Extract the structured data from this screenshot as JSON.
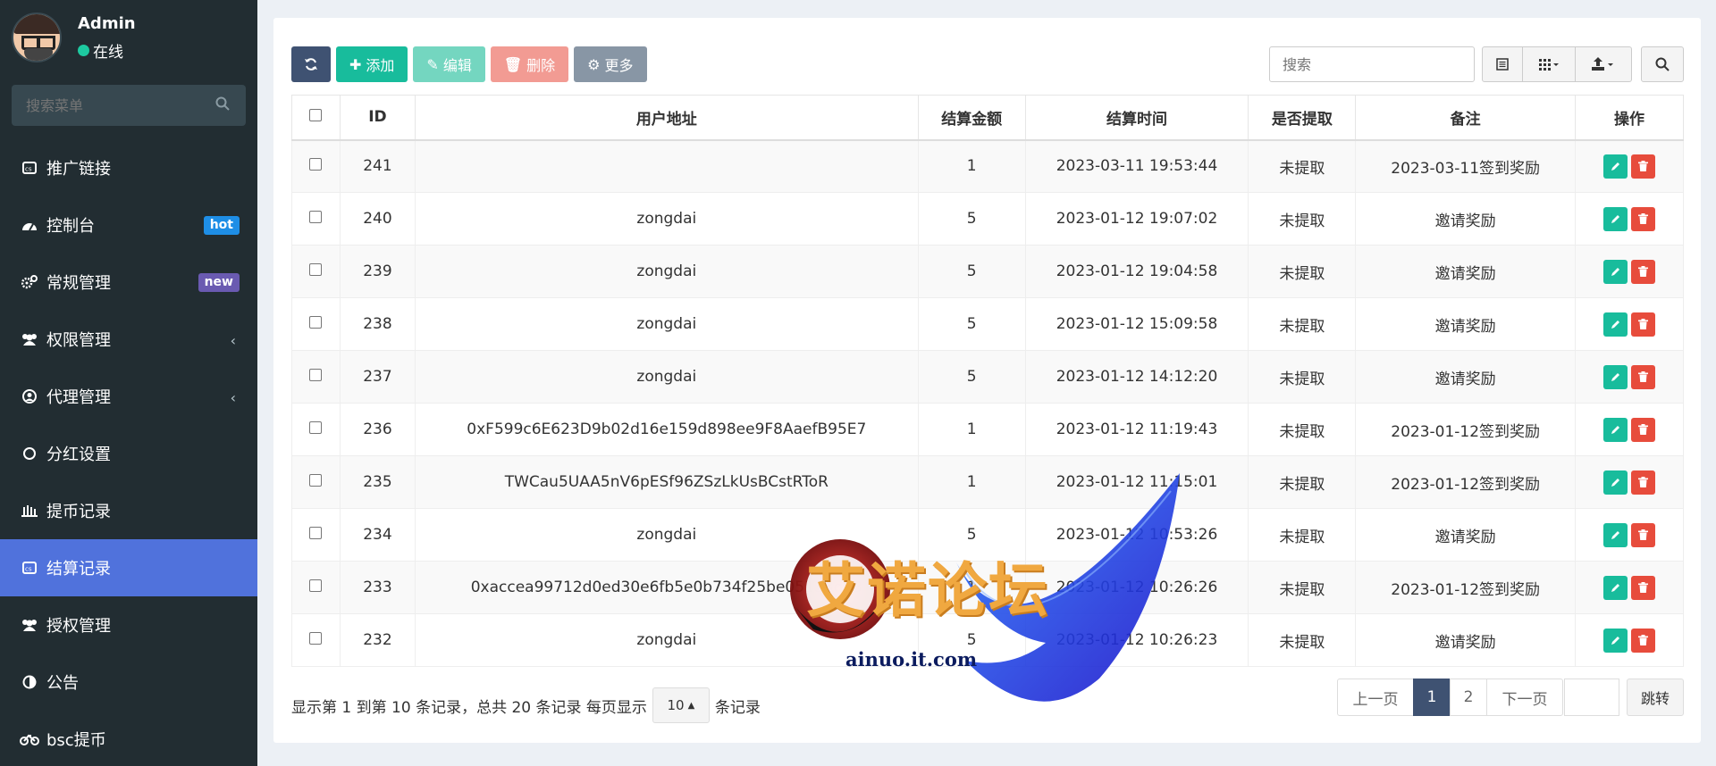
{
  "user": {
    "name": "Admin",
    "status": "在线"
  },
  "sidebar_search": {
    "placeholder": "搜索菜单"
  },
  "menu": [
    {
      "label": "推广链接",
      "icon": "link-icon"
    },
    {
      "label": "控制台",
      "icon": "dashboard-icon",
      "badge": "hot"
    },
    {
      "label": "常规管理",
      "icon": "cogs-icon",
      "badge": "new"
    },
    {
      "label": "权限管理",
      "icon": "users-icon",
      "chevron": true
    },
    {
      "label": "代理管理",
      "icon": "user-circle-icon",
      "chevron": true
    },
    {
      "label": "分红设置",
      "icon": "circle-icon"
    },
    {
      "label": "提币记录",
      "icon": "bars-icon"
    },
    {
      "label": "结算记录",
      "icon": "link-icon",
      "active": true
    },
    {
      "label": "授权管理",
      "icon": "users-icon"
    },
    {
      "label": "公告",
      "icon": "adjust-icon"
    },
    {
      "label": "bsc提币",
      "icon": "bicycle-icon"
    }
  ],
  "toolbar": {
    "add": "添加",
    "edit": "编辑",
    "delete": "删除",
    "more": "更多"
  },
  "search": {
    "placeholder": "搜索"
  },
  "columns": [
    "ID",
    "用户地址",
    "结算金额",
    "结算时间",
    "是否提取",
    "备注",
    "操作"
  ],
  "rows": [
    {
      "id": "241",
      "address": "",
      "amount": "1",
      "time": "2023-03-11 19:53:44",
      "extracted": "未提取",
      "note": "2023-03-11签到奖励"
    },
    {
      "id": "240",
      "address": "zongdai",
      "amount": "5",
      "time": "2023-01-12 19:07:02",
      "extracted": "未提取",
      "note": "邀请奖励"
    },
    {
      "id": "239",
      "address": "zongdai",
      "amount": "5",
      "time": "2023-01-12 19:04:58",
      "extracted": "未提取",
      "note": "邀请奖励"
    },
    {
      "id": "238",
      "address": "zongdai",
      "amount": "5",
      "time": "2023-01-12 15:09:58",
      "extracted": "未提取",
      "note": "邀请奖励"
    },
    {
      "id": "237",
      "address": "zongdai",
      "amount": "5",
      "time": "2023-01-12 14:12:20",
      "extracted": "未提取",
      "note": "邀请奖励"
    },
    {
      "id": "236",
      "address": "0xF599c6E623D9b02d16e159d898ee9F8AaefB95E7",
      "amount": "1",
      "time": "2023-01-12 11:19:43",
      "extracted": "未提取",
      "note": "2023-01-12签到奖励"
    },
    {
      "id": "235",
      "address": "TWCau5UAA5nV6pESf96ZSzLkUsBCstRToR",
      "amount": "1",
      "time": "2023-01-12 11:15:01",
      "extracted": "未提取",
      "note": "2023-01-12签到奖励"
    },
    {
      "id": "234",
      "address": "zongdai",
      "amount": "5",
      "time": "2023-01-12 10:53:26",
      "extracted": "未提取",
      "note": "邀请奖励"
    },
    {
      "id": "233",
      "address": "0xaccea99712d0ed30e6fb5e0b734f25be05133d53",
      "amount": "1",
      "time": "2023-01-12 10:26:26",
      "extracted": "未提取",
      "note": "2023-01-12签到奖励"
    },
    {
      "id": "232",
      "address": "zongdai",
      "amount": "5",
      "time": "2023-01-12 10:26:23",
      "extracted": "未提取",
      "note": "邀请奖励"
    }
  ],
  "footer": {
    "summary": "显示第 1 到第 10 条记录，总共 20 条记录 每页显示",
    "page_size": "10",
    "suffix": "条记录"
  },
  "pager": {
    "prev": "上一页",
    "pages": [
      "1",
      "2"
    ],
    "current": "1",
    "next": "下一页",
    "jump": "跳转"
  },
  "watermark": {
    "text": "艾诺论坛",
    "url": "ainuo.it.com"
  },
  "colors": {
    "sidebar": "#222d32",
    "active_menu": "#5072dc",
    "primary_dark": "#3f5272",
    "success": "#18bc9c",
    "danger": "#e74c3c"
  }
}
